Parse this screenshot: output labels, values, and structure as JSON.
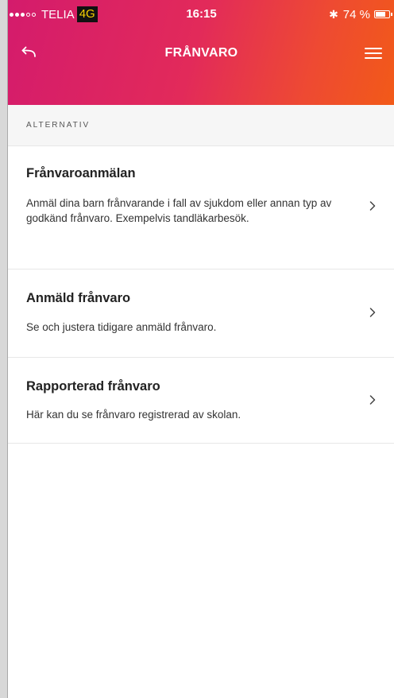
{
  "status_bar": {
    "carrier": "TELIA",
    "network": "4G",
    "time": "16:15",
    "battery": "74 %",
    "battery_level": 0.74,
    "signal_strength": 3,
    "signal_max": 5
  },
  "nav": {
    "title": "FRÅNVARO",
    "back_icon": "back-arrow-icon",
    "menu_icon": "hamburger-menu-icon"
  },
  "section": {
    "label": "ALTERNATIV"
  },
  "items": [
    {
      "title": "Frånvaroanmälan",
      "description": "Anmäl dina barn frånvarande i fall av sjukdom eller annan typ av godkänd frånvaro. Exempelvis tandläkarbesök."
    },
    {
      "title": "Anmäld frånvaro",
      "description": "Se och justera tidigare anmäld frånvaro."
    },
    {
      "title": "Rapporterad frånvaro",
      "description": "Här kan du se frånvaro registrerad av skolan."
    }
  ],
  "colors": {
    "header_gradient_start": "#d41b6c",
    "header_gradient_end": "#f25a18",
    "section_background": "#f6f6f6"
  }
}
